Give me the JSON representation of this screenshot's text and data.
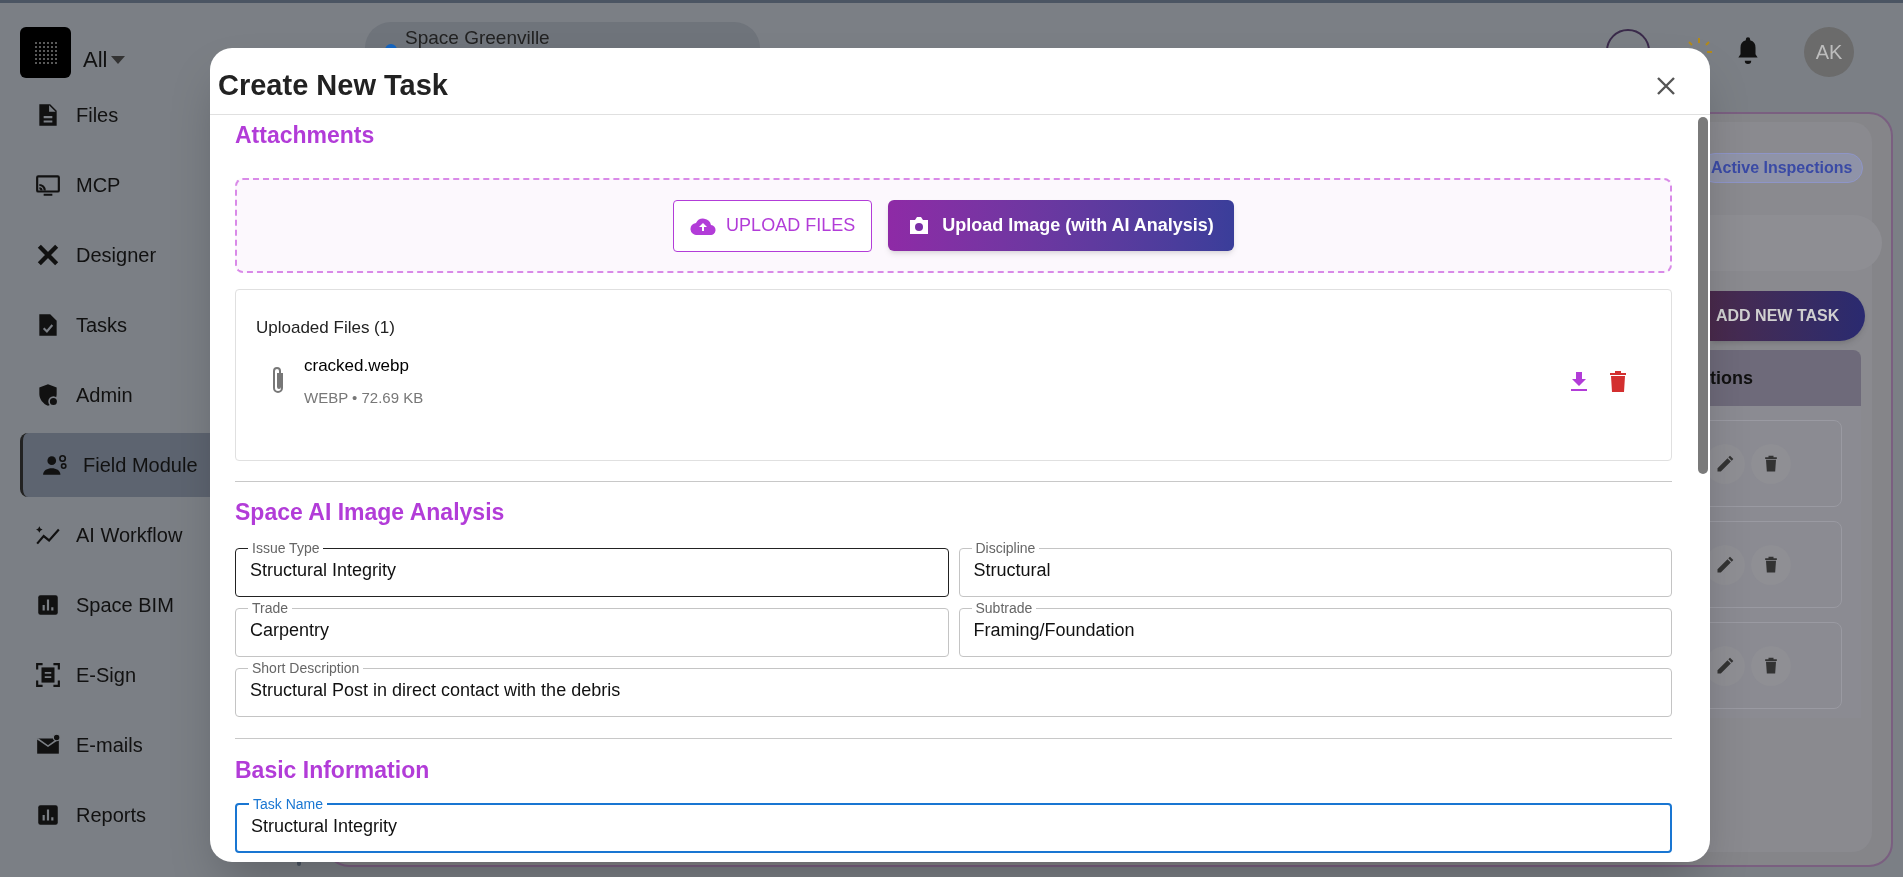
{
  "sidebar": {
    "workspace": "All",
    "items": [
      {
        "label": "Files",
        "selected": false
      },
      {
        "label": "MCP",
        "selected": false
      },
      {
        "label": "Designer",
        "selected": false
      },
      {
        "label": "Tasks",
        "selected": false
      },
      {
        "label": "Admin",
        "selected": false
      },
      {
        "label": "Field Module",
        "selected": true
      },
      {
        "label": "AI Workflow",
        "selected": false
      },
      {
        "label": "Space BIM",
        "selected": false
      },
      {
        "label": "E-Sign",
        "selected": false
      },
      {
        "label": "E-mails",
        "selected": false
      },
      {
        "label": "Reports",
        "selected": false
      }
    ]
  },
  "header": {
    "project": "Space Greenville",
    "avatar": "AK"
  },
  "background_panel": {
    "chip": "Active Inspections",
    "add_button": "ADD NEW TASK",
    "table_header": "tions",
    "rows": [
      {
        "kind": "task"
      },
      {
        "kind": "task"
      },
      {
        "kind": "task"
      }
    ]
  },
  "modal": {
    "title": "Create New Task",
    "attachments": {
      "heading": "Attachments",
      "upload_button": "UPLOAD FILES",
      "ai_button": "Upload Image (with AI Analysis)",
      "uploaded_title": "Uploaded Files (1)",
      "files": [
        {
          "name": "cracked.webp",
          "meta": "WEBP • 72.69 KB"
        }
      ]
    },
    "analysis": {
      "heading": "Space AI Image Analysis",
      "rows": [
        [
          {
            "label": "Issue Type",
            "value": "Structural Integrity",
            "hovered": true,
            "focused": false
          },
          {
            "label": "Discipline",
            "value": "Structural",
            "hovered": false,
            "focused": false
          }
        ],
        [
          {
            "label": "Trade",
            "value": "Carpentry",
            "hovered": false,
            "focused": false
          },
          {
            "label": "Subtrade",
            "value": "Framing/Foundation",
            "hovered": false,
            "focused": false
          }
        ],
        [
          {
            "label": "Short Description",
            "value": "Structural Post in direct contact with the debris",
            "hovered": false,
            "focused": false
          }
        ]
      ]
    },
    "basic": {
      "heading": "Basic Information",
      "rows": [
        [
          {
            "label": "Task Name",
            "value": "Structural Integrity",
            "hovered": false,
            "focused": true
          }
        ]
      ]
    }
  }
}
